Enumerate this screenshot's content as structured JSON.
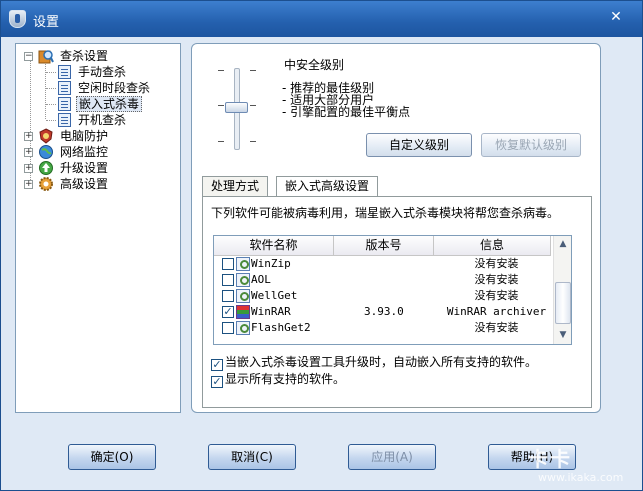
{
  "window": {
    "title": "设置",
    "close_label": "✕"
  },
  "tree": {
    "nodes": [
      {
        "label": "查杀设置",
        "expander": "−"
      },
      {
        "label": "手动查杀"
      },
      {
        "label": "空闲时段查杀"
      },
      {
        "label": "嵌入式杀毒"
      },
      {
        "label": "开机查杀"
      },
      {
        "label": "电脑防护",
        "expander": "+"
      },
      {
        "label": "网络监控",
        "expander": "+"
      },
      {
        "label": "升级设置",
        "expander": "+"
      },
      {
        "label": "高级设置",
        "expander": "+"
      }
    ],
    "selected": "嵌入式杀毒"
  },
  "security": {
    "level_title": "中安全级别",
    "desc_lines": [
      "- 推荐的最佳级别",
      "- 适用大部分用户",
      "- 引擎配置的最佳平衡点"
    ],
    "slider_level": "2 of 4",
    "custom_button": "自定义级别",
    "restore_button": "恢复默认级别"
  },
  "tabs": [
    {
      "label": "处理方式"
    },
    {
      "label": "嵌入式高级设置"
    }
  ],
  "embedded": {
    "intro": "下列软件可能被病毒利用，瑞星嵌入式杀毒模块将帮您查杀病毒。",
    "columns": [
      "软件名称",
      "版本号",
      "信息"
    ],
    "rows": [
      {
        "checked": "",
        "name": "WinZip",
        "version": "",
        "info": "没有安装"
      },
      {
        "checked": "",
        "name": "AOL",
        "version": "",
        "info": "没有安装"
      },
      {
        "checked": "",
        "name": "WellGet",
        "version": "",
        "info": "没有安装"
      },
      {
        "checked": "✓",
        "name": "WinRAR",
        "version": "3.93.0",
        "info": "WinRAR archiver"
      },
      {
        "checked": "",
        "name": "FlashGet2",
        "version": "",
        "info": "没有安装"
      }
    ],
    "scroll_up": "▲",
    "scroll_down": "▼",
    "option_auto": "当嵌入式杀毒设置工具升级时，自动嵌入所有支持的软件。",
    "option_show_all": "显示所有支持的软件。",
    "option_check": "✓"
  },
  "footer": {
    "ok": "确定(O)",
    "cancel": "取消(C)",
    "apply": "应用(A)",
    "help": "帮助(H)"
  },
  "watermark": {
    "brand": "卡卡",
    "url": "www.ikaka.com"
  }
}
